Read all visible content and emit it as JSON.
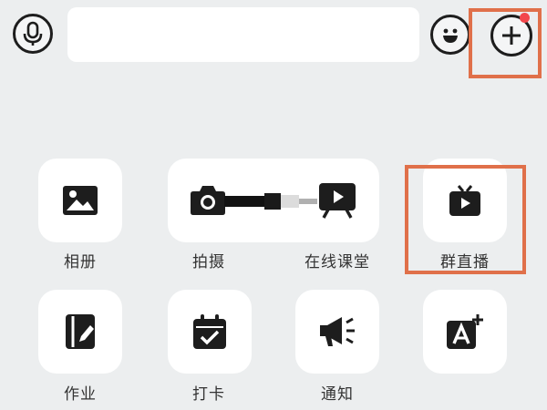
{
  "input_bar": {
    "mic_icon": "microphone-icon",
    "text_value": "",
    "emoji_icon": "smiley-icon",
    "plus_icon": "plus-icon",
    "notification_color": "#f2464b"
  },
  "grid": {
    "row1": [
      {
        "label": "相册",
        "icon": "photo-icon"
      },
      {
        "label": "拍摄",
        "icon": "camera-icon"
      },
      {
        "label": "在线课堂",
        "icon": "tv-board-icon"
      },
      {
        "label": "群直播",
        "icon": "live-tv-icon"
      }
    ],
    "row2": [
      {
        "label": "作业",
        "icon": "homework-icon"
      },
      {
        "label": "打卡",
        "icon": "checkin-calendar-icon"
      },
      {
        "label": "通知",
        "icon": "megaphone-icon"
      },
      {
        "label": "",
        "icon": "text-add-icon"
      }
    ]
  },
  "colors": {
    "highlight": "#e0704a",
    "icon": "#1d1d1d",
    "background": "#eceeef"
  }
}
